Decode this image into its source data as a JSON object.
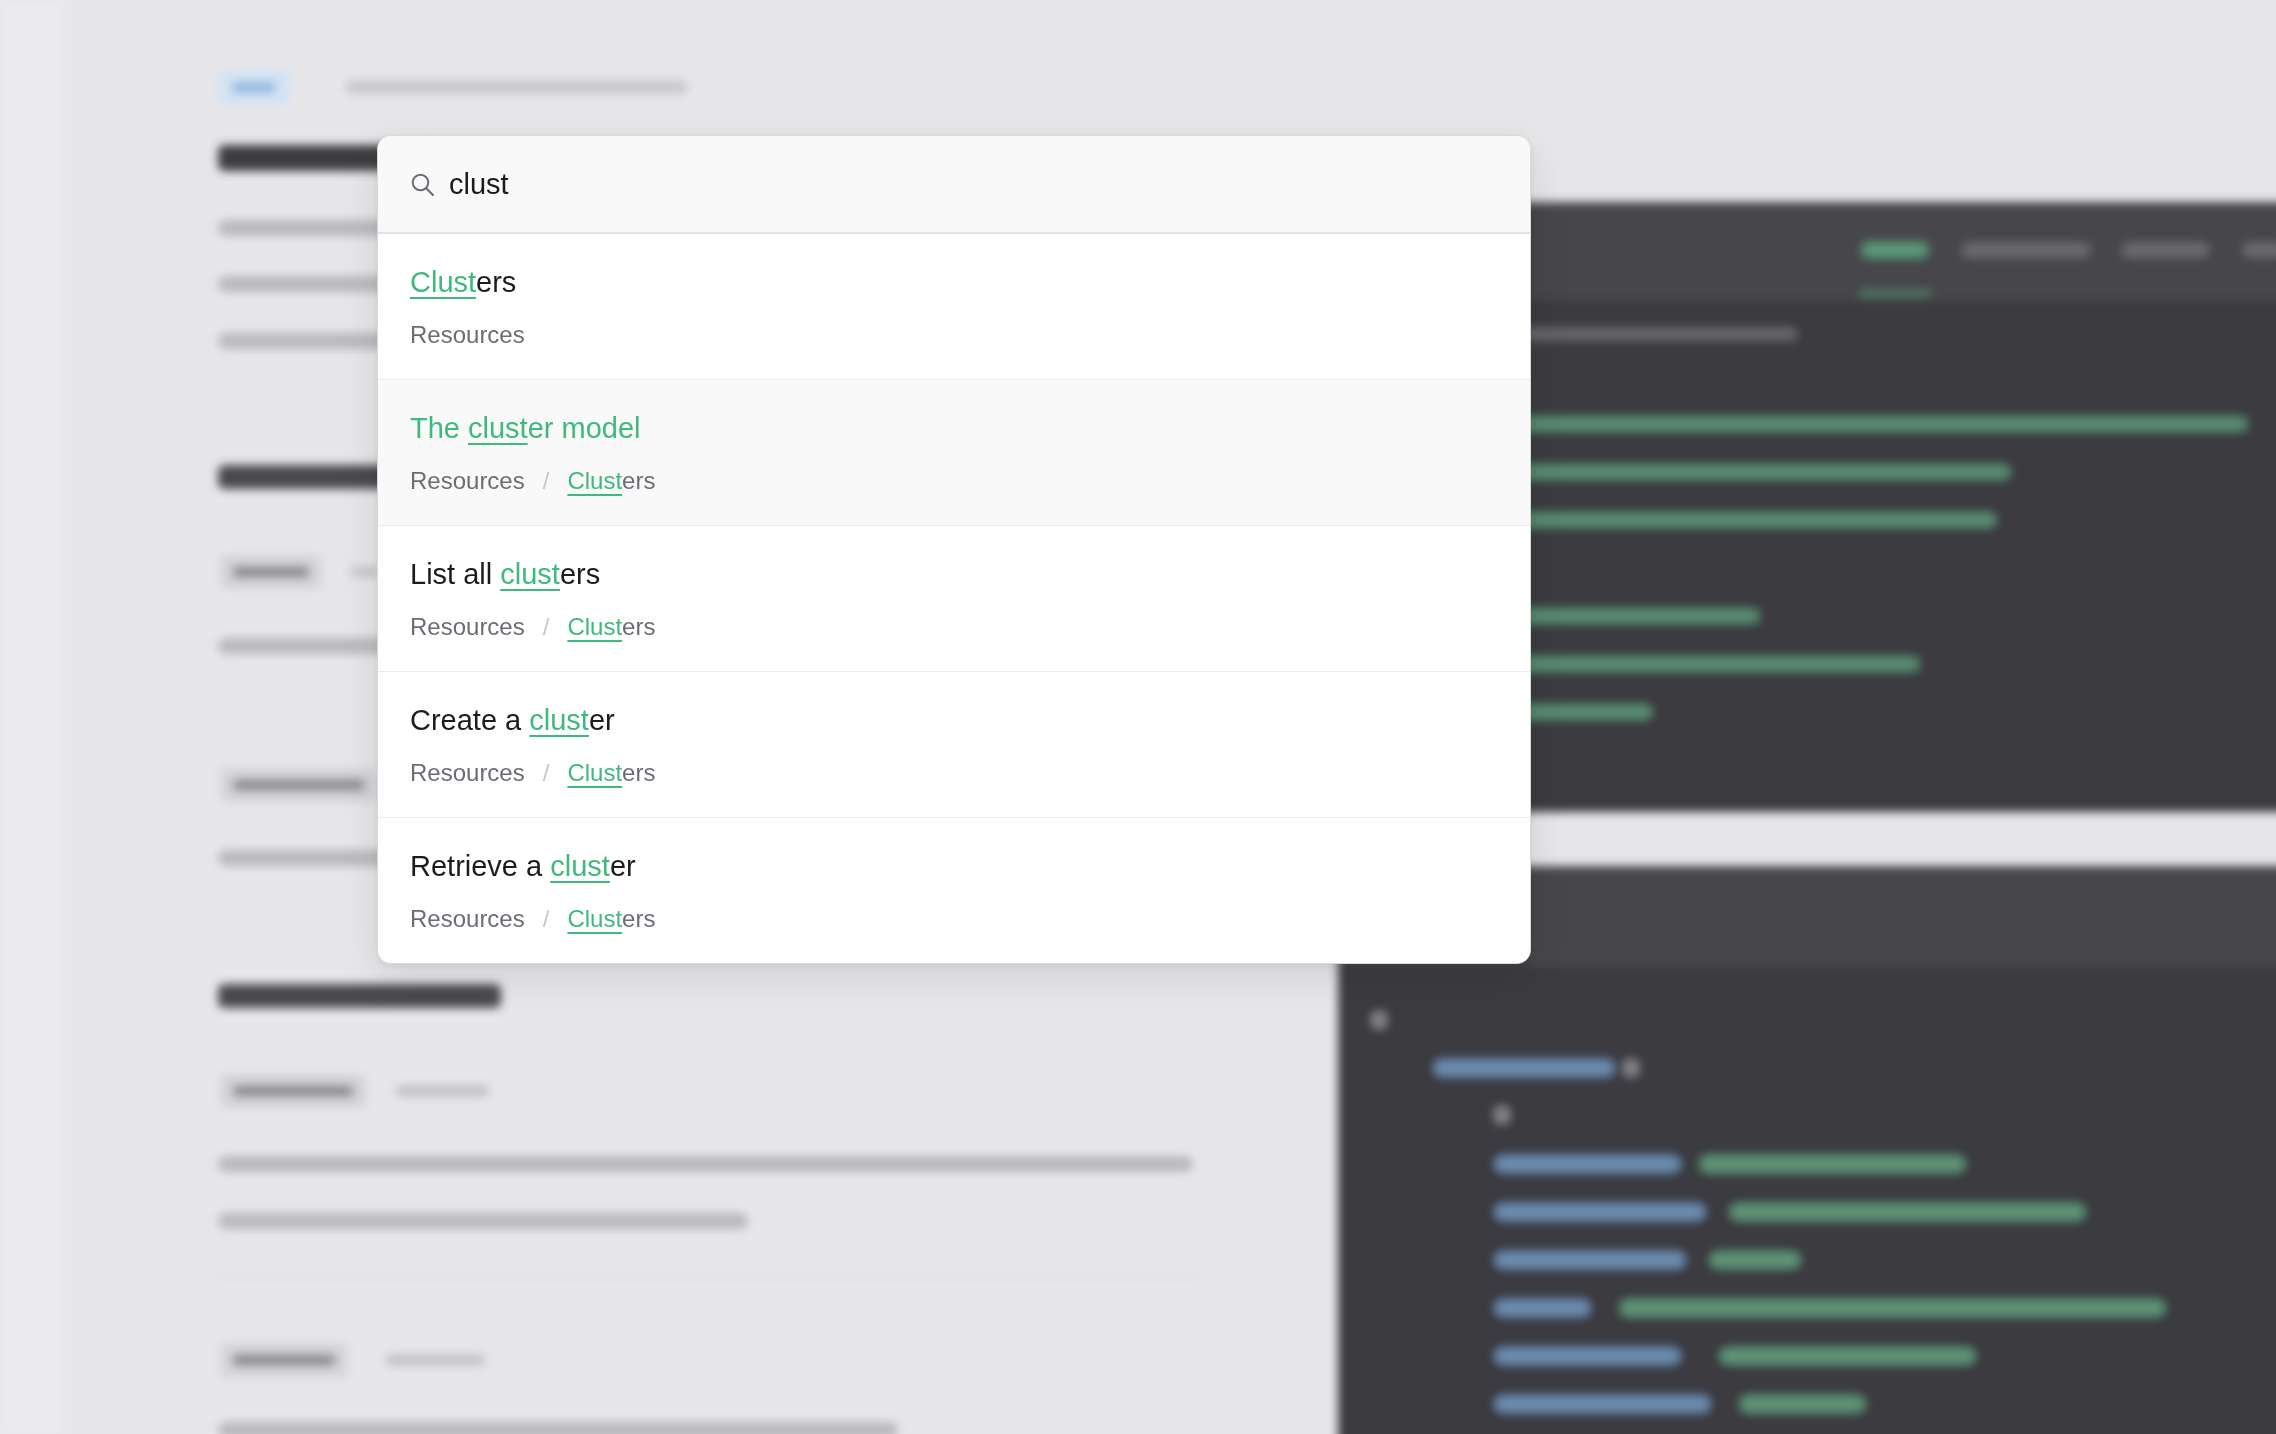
{
  "search": {
    "value": "clust"
  },
  "results": [
    {
      "selected": false,
      "title": [
        {
          "text": "Clust",
          "match": true
        },
        {
          "text": "ers",
          "match": false
        }
      ],
      "path": [
        {
          "kind": "crumb",
          "parts": [
            {
              "text": "Resources",
              "match": false
            }
          ]
        }
      ]
    },
    {
      "selected": true,
      "title": [
        {
          "text": "The ",
          "match": false
        },
        {
          "text": "clust",
          "match": true
        },
        {
          "text": "er model",
          "match": false
        }
      ],
      "path": [
        {
          "kind": "crumb",
          "parts": [
            {
              "text": "Resources",
              "match": false
            }
          ]
        },
        {
          "kind": "separator",
          "text": "/"
        },
        {
          "kind": "crumb",
          "parts": [
            {
              "text": "Clust",
              "match": true
            },
            {
              "text": "ers",
              "match": false
            }
          ]
        }
      ]
    },
    {
      "selected": false,
      "title": [
        {
          "text": "List all ",
          "match": false
        },
        {
          "text": "clust",
          "match": true
        },
        {
          "text": "ers",
          "match": false
        }
      ],
      "path": [
        {
          "kind": "crumb",
          "parts": [
            {
              "text": "Resources",
              "match": false
            }
          ]
        },
        {
          "kind": "separator",
          "text": "/"
        },
        {
          "kind": "crumb",
          "parts": [
            {
              "text": "Clust",
              "match": true
            },
            {
              "text": "ers",
              "match": false
            }
          ]
        }
      ]
    },
    {
      "selected": false,
      "title": [
        {
          "text": "Create a ",
          "match": false
        },
        {
          "text": "clust",
          "match": true
        },
        {
          "text": "er",
          "match": false
        }
      ],
      "path": [
        {
          "kind": "crumb",
          "parts": [
            {
              "text": "Resources",
              "match": false
            }
          ]
        },
        {
          "kind": "separator",
          "text": "/"
        },
        {
          "kind": "crumb",
          "parts": [
            {
              "text": "Clust",
              "match": true
            },
            {
              "text": "ers",
              "match": false
            }
          ]
        }
      ]
    },
    {
      "selected": false,
      "title": [
        {
          "text": "Retrieve a ",
          "match": false
        },
        {
          "text": "clust",
          "match": true
        },
        {
          "text": "er",
          "match": false
        }
      ],
      "path": [
        {
          "kind": "crumb",
          "parts": [
            {
              "text": "Resources",
              "match": false
            }
          ]
        },
        {
          "kind": "separator",
          "text": "/"
        },
        {
          "kind": "crumb",
          "parts": [
            {
              "text": "Clust",
              "match": true
            },
            {
              "text": "ers",
              "match": false
            }
          ]
        }
      ]
    }
  ]
}
